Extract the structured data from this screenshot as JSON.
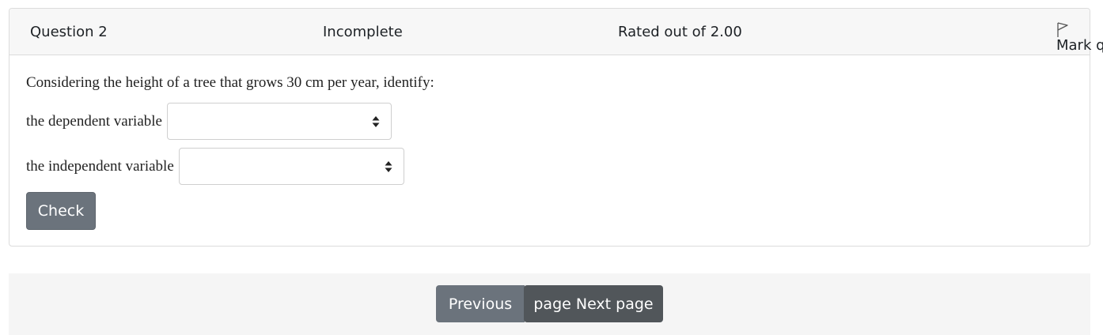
{
  "question": {
    "number_label": "Question 2",
    "state": "Incomplete",
    "grade": "Rated out of 2.00",
    "flag_label": "Mark question",
    "text": "Considering the height of a tree that grows 30 cm per year, identify:",
    "subquestions": [
      {
        "label": "the dependent variable",
        "selected": ""
      },
      {
        "label": "the independent variable",
        "selected": ""
      }
    ],
    "check_label": "Check"
  },
  "navigation": {
    "previous_label": "Previous",
    "next_label": "page Next page"
  },
  "icons": {
    "flag": "flag-icon",
    "select_caret": "sort-caret-icon"
  },
  "colors": {
    "header_bg": "#f7f7f7",
    "secondary_button": "#6b737c",
    "dark_button": "#51565a",
    "nav_bg": "#f5f5f5"
  }
}
